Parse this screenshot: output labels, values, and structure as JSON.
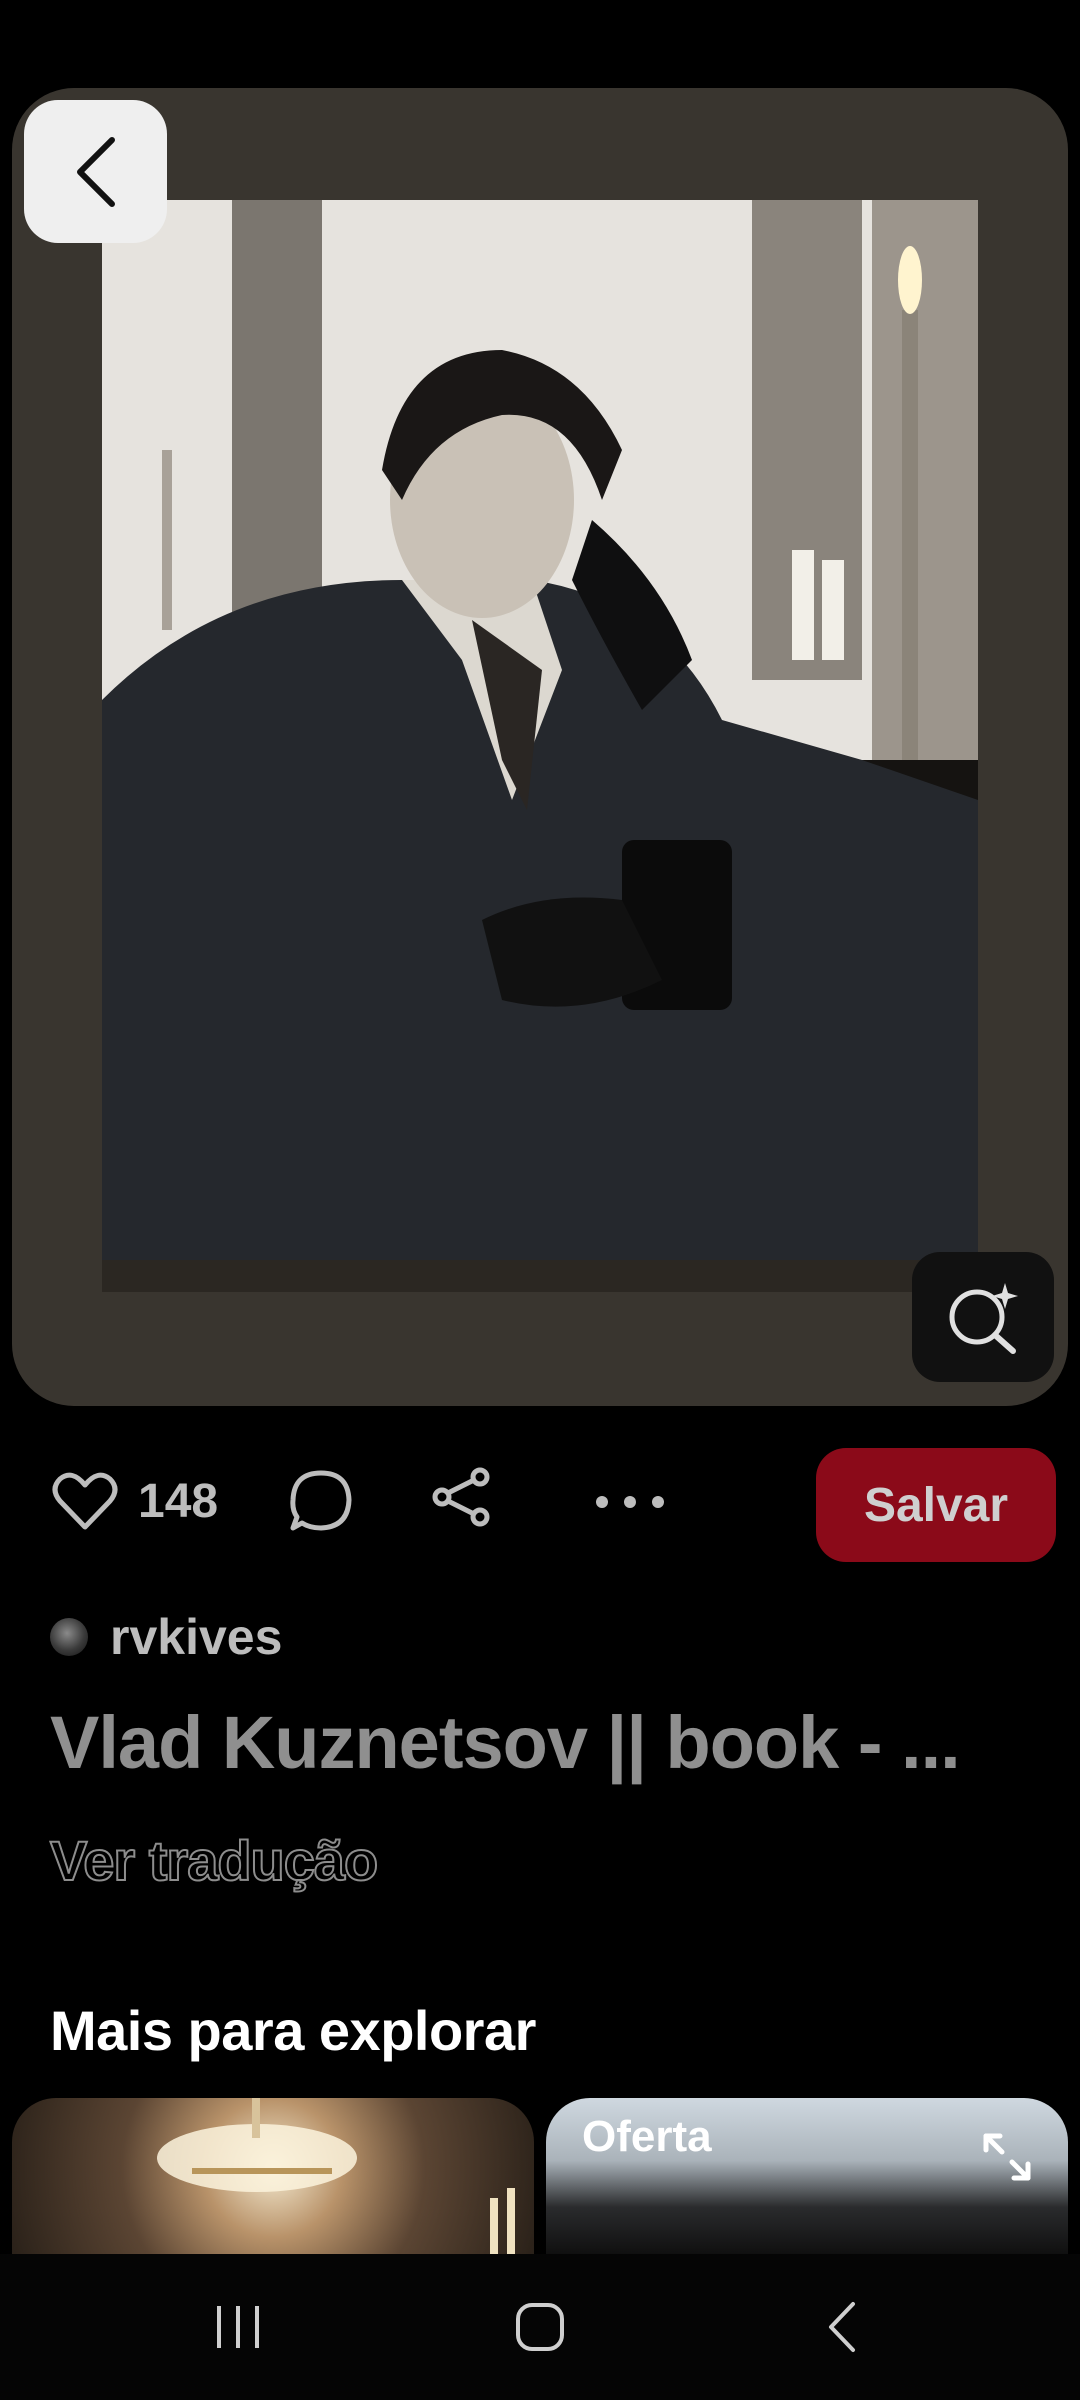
{
  "pin": {
    "like_count": "148",
    "save_label": "Salvar",
    "author": "rvkives",
    "title": "Vlad Kuznetsov || book - ...",
    "translate_label": "Ver tradução"
  },
  "explore": {
    "section_title": "Mais para explorar",
    "cards": [
      {
        "badge": ""
      },
      {
        "badge": "Oferta"
      }
    ]
  },
  "colors": {
    "save_button": "#8b0a19",
    "card_background": "#39352f"
  },
  "icons": [
    "back-arrow-icon",
    "visual-search-icon",
    "heart-icon",
    "comment-icon",
    "share-icon",
    "more-icon",
    "expand-icon",
    "recent-apps-icon",
    "home-icon",
    "nav-back-icon"
  ]
}
